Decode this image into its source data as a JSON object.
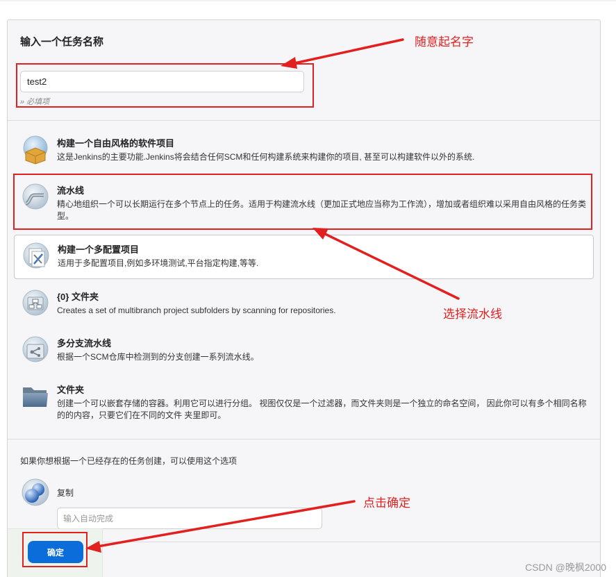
{
  "form": {
    "name_title": "输入一个任务名称",
    "name_value": "test2",
    "required_note": "» 必填项"
  },
  "items": [
    {
      "title": "构建一个自由风格的软件项目",
      "desc": "这是Jenkins的主要功能.Jenkins将会结合任何SCM和任何构建系统来构建你的项目, 甚至可以构建软件以外的系统.",
      "icon": "freestyle-project-icon"
    },
    {
      "title": "流水线",
      "desc": "精心地组织一个可以长期运行在多个节点上的任务。适用于构建流水线（更加正式地应当称为工作流），增加或者组织难以采用自由风格的任务类型。",
      "icon": "pipeline-icon"
    },
    {
      "title": "构建一个多配置项目",
      "desc": "适用于多配置项目,例如多环境测试,平台指定构建,等等.",
      "icon": "multi-config-icon"
    },
    {
      "title": "{0} 文件夹",
      "desc": "Creates a set of multibranch project subfolders by scanning for repositories.",
      "icon": "org-folder-icon"
    },
    {
      "title": "多分支流水线",
      "desc": "根据一个SCM仓库中检测到的分支创建一系列流水线。",
      "icon": "multibranch-pipeline-icon"
    },
    {
      "title": "文件夹",
      "desc": "创建一个可以嵌套存储的容器。利用它可以进行分组。 视图仅仅是一个过滤器，而文件夹则是一个独立的命名空间， 因此你可以有多个相同名称的的内容，只要它们在不同的文件 夹里即可。",
      "icon": "folder-icon"
    }
  ],
  "copy": {
    "section_label": "如果你想根据一个已经存在的任务创建，可以使用这个选项",
    "label": "复制",
    "placeholder": "输入自动完成"
  },
  "ok_button": "确定",
  "annotations": {
    "name_hint": "随意起名字",
    "pipeline_hint": "选择流水线",
    "ok_hint": "点击确定",
    "color": "#e1201f"
  },
  "watermark": "CSDN @晚枫2000",
  "colors": {
    "primary_button": "#0b6dd9"
  }
}
